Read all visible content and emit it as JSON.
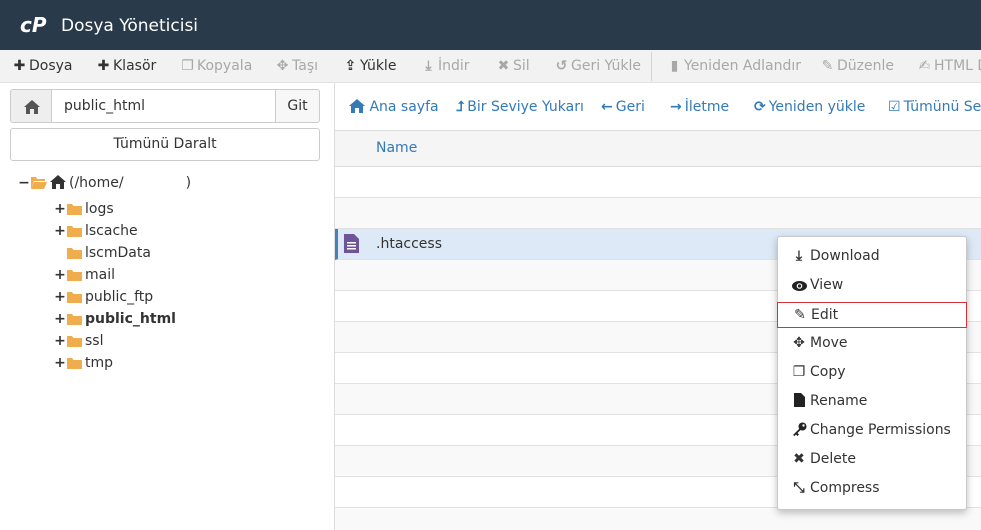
{
  "header": {
    "title": "Dosya Yöneticisi"
  },
  "toolbar": {
    "items": [
      {
        "label": "Dosya",
        "icon": "plus-icon",
        "enabled": true
      },
      {
        "label": "Klasör",
        "icon": "plus-icon",
        "enabled": true
      },
      {
        "label": "Kopyala",
        "icon": "copy-icon",
        "enabled": false
      },
      {
        "label": "Taşı",
        "icon": "move-icon",
        "enabled": false
      },
      {
        "label": "Yükle",
        "icon": "upload-icon",
        "enabled": true
      },
      {
        "label": "İndir",
        "icon": "download-icon",
        "enabled": false
      },
      {
        "label": "Sil",
        "icon": "delete-icon",
        "enabled": false
      },
      {
        "label": "Geri Yükle",
        "icon": "undo-icon",
        "enabled": false
      },
      {
        "label": "Yeniden Adlandır",
        "icon": "file-icon",
        "enabled": false
      },
      {
        "label": "Düzenle",
        "icon": "pencil-icon",
        "enabled": false
      },
      {
        "label": "HTML D",
        "icon": "edit-icon",
        "enabled": false
      }
    ]
  },
  "left": {
    "path_value": "public_html",
    "go_label": "Git",
    "collapse_label": "Tümünü Daralt",
    "tree": {
      "root_label": "(/home/",
      "root_close": ")",
      "items": [
        {
          "label": "logs",
          "expandable": true,
          "bold": false
        },
        {
          "label": "lscache",
          "expandable": true,
          "bold": false
        },
        {
          "label": "lscmData",
          "expandable": false,
          "bold": false
        },
        {
          "label": "mail",
          "expandable": true,
          "bold": false
        },
        {
          "label": "public_ftp",
          "expandable": true,
          "bold": false
        },
        {
          "label": "public_html",
          "expandable": true,
          "bold": true
        },
        {
          "label": "ssl",
          "expandable": true,
          "bold": false
        },
        {
          "label": "tmp",
          "expandable": true,
          "bold": false
        }
      ]
    }
  },
  "nav": {
    "items": [
      {
        "label": "Ana sayfa",
        "icon": "home-icon"
      },
      {
        "label": "Bir Seviye Yukarı",
        "icon": "level-up-icon"
      },
      {
        "label": "Geri",
        "icon": "arrow-left-icon"
      },
      {
        "label": "İletme",
        "icon": "arrow-right-icon"
      },
      {
        "label": "Yeniden yükle",
        "icon": "refresh-icon"
      },
      {
        "label": "Tümünü Seç",
        "icon": "checkbox-icon"
      }
    ]
  },
  "table": {
    "column_name": "Name",
    "selected_file": ".htaccess"
  },
  "context_menu": {
    "items": [
      {
        "label": "Download",
        "icon": "download-icon"
      },
      {
        "label": "View",
        "icon": "eye-icon"
      },
      {
        "label": "Edit",
        "icon": "pencil-icon"
      },
      {
        "label": "Move",
        "icon": "move-icon"
      },
      {
        "label": "Copy",
        "icon": "copy-icon"
      },
      {
        "label": "Rename",
        "icon": "file-icon"
      },
      {
        "label": "Change Permissions",
        "icon": "key-icon"
      },
      {
        "label": "Delete",
        "icon": "close-icon"
      },
      {
        "label": "Compress",
        "icon": "compress-icon"
      }
    ],
    "highlighted": "Edit"
  },
  "colors": {
    "header_bg": "#293a4a",
    "link": "#337ab7",
    "folder": "#f0ad4e",
    "highlight_border": "#d0353d",
    "selected_row": "#dde9f7"
  }
}
